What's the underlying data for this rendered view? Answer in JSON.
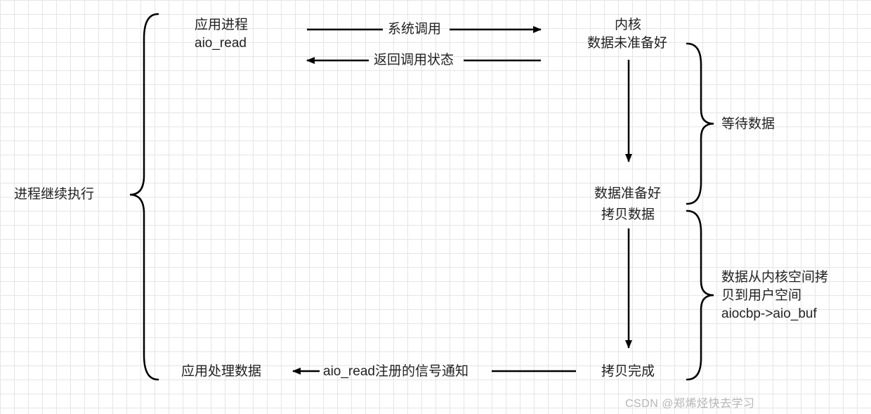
{
  "diagram": {
    "left_brace_label": "进程继续执行",
    "app_process_line1": "应用进程",
    "app_process_line2": "aio_read",
    "arrow_syscall": "系统调用",
    "arrow_return_status": "返回调用状态",
    "kernel_line1": "内核",
    "kernel_line2": "数据未准备好",
    "right_brace1_label": "等待数据",
    "data_ready": "数据准备好",
    "copy_data": "拷贝数据",
    "right_brace2_line1": "数据从内核空间拷",
    "right_brace2_line2": "贝到用户空间",
    "right_brace2_line3": "aiocbp->aio_buf",
    "copy_done": "拷贝完成",
    "arrow_signal": "aio_read注册的信号通知",
    "app_handle_data": "应用处理数据"
  },
  "watermark": "CSDN @郑烯烃快去学习"
}
